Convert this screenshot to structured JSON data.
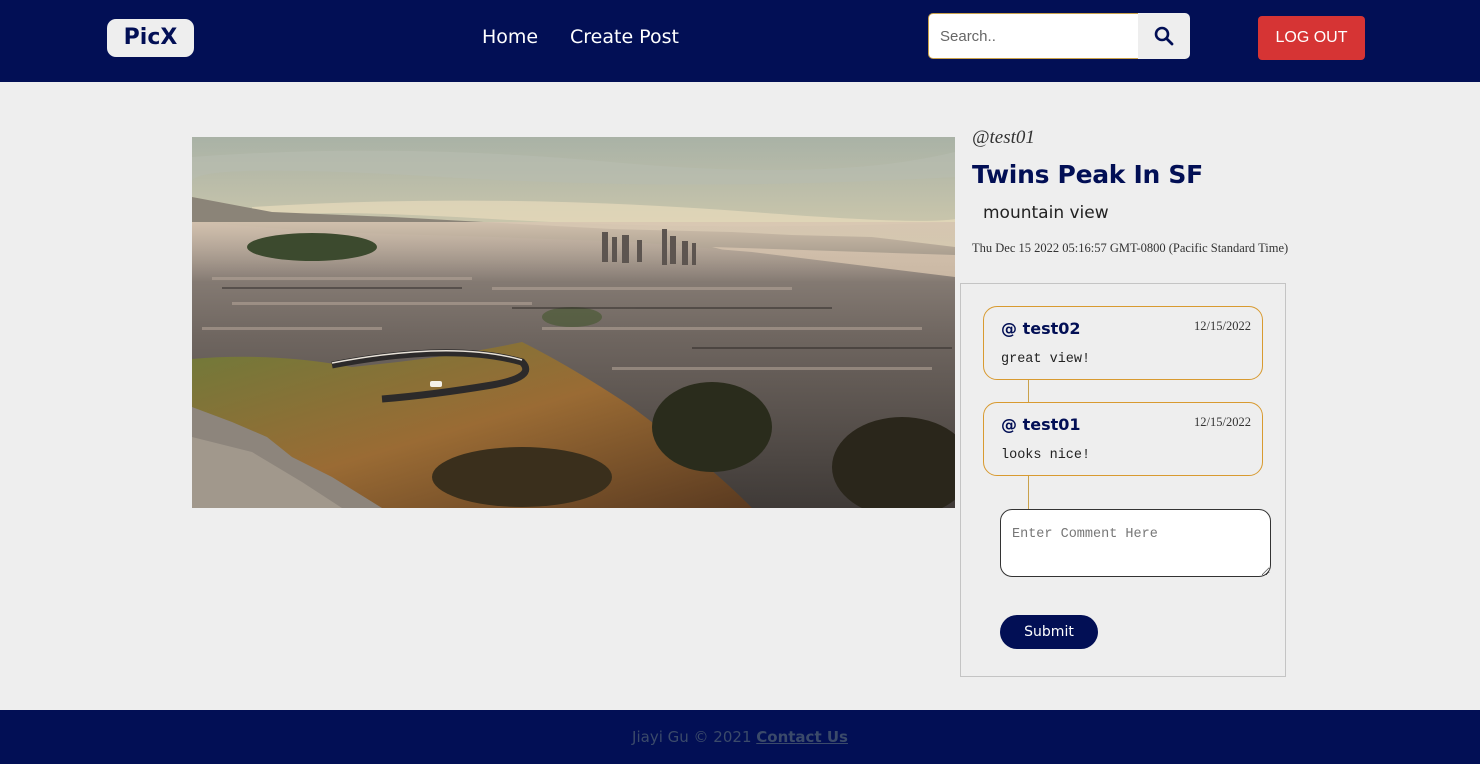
{
  "navbar": {
    "brand": "PicX",
    "links": [
      {
        "label": "Home"
      },
      {
        "label": "Create Post"
      }
    ],
    "search": {
      "placeholder": "Search..",
      "value": ""
    },
    "logout_label": "LOG OUT"
  },
  "post": {
    "author": "@test01",
    "title": "Twins Peak In SF",
    "description": "mountain view",
    "date": "Thu Dec 15 2022 05:16:57 GMT-0800 (Pacific Standard Time)"
  },
  "comments": [
    {
      "user": "@ test02",
      "date": "12/15/2022",
      "text": "great view!"
    },
    {
      "user": "@ test01",
      "date": "12/15/2022",
      "text": "looks nice!"
    }
  ],
  "comment_form": {
    "placeholder": "Enter Comment Here",
    "value": "",
    "submit_label": "Submit"
  },
  "footer": {
    "copyright": "Jiayi Gu © 2021 ",
    "contact_label": "Contact Us"
  },
  "colors": {
    "navbar": "#020f55",
    "logout": "#d63434",
    "comment_border": "#d89a30",
    "background": "#eeeeee"
  }
}
